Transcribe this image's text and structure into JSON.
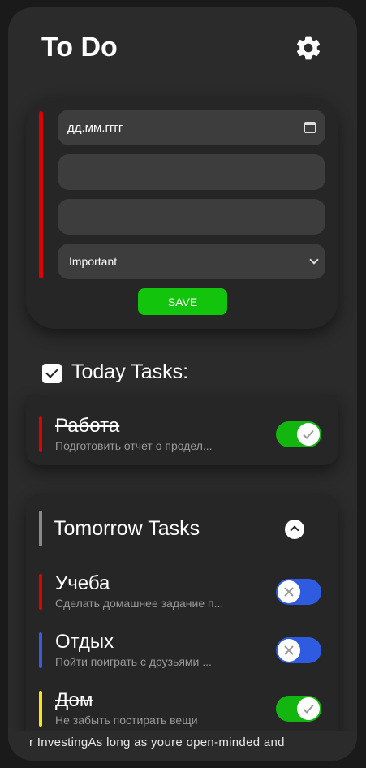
{
  "header": {
    "title": "To Do",
    "settings_icon": "gear-icon"
  },
  "form": {
    "accent_color": "#e00000",
    "date_value": "дд.мм.гггг",
    "title_value": "",
    "description_value": "",
    "priority_value": "Important",
    "save_label": "SAVE",
    "save_color": "#13c40c"
  },
  "today": {
    "checked": true,
    "title": "Today Tasks:",
    "tasks": [
      {
        "name": "Работа",
        "desc": "Подготовить отчет о продел...",
        "color": "#e00000",
        "done": true
      }
    ]
  },
  "tomorrow": {
    "title": "Tomorrow Tasks",
    "bar_color": "#8a8a8a",
    "tasks": [
      {
        "name": "Учеба",
        "desc": "Сделать домашнее задание п...",
        "color": "#e00000",
        "done": false
      },
      {
        "name": "Отдых",
        "desc": "Пойти поиграть с друзьями ...",
        "color": "#3b5bdb",
        "done": false
      },
      {
        "name": "Дом",
        "desc": "Не забыть постирать вещи",
        "color": "#f5e61a",
        "done": true
      }
    ]
  },
  "ticker": {
    "text": "r InvestingAs long as youre open-minded and"
  }
}
